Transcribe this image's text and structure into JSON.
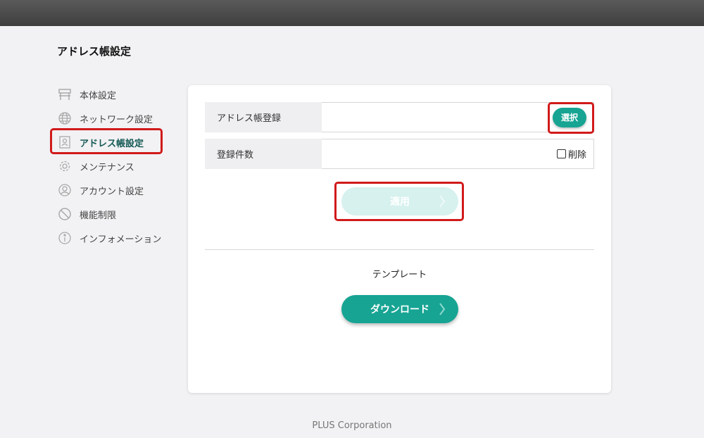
{
  "page_title": "アドレス帳設定",
  "sidebar": {
    "items": [
      {
        "label": "本体設定",
        "icon": "printer-icon"
      },
      {
        "label": "ネットワーク設定",
        "icon": "globe-icon"
      },
      {
        "label": "アドレス帳設定",
        "icon": "address-book-icon",
        "active": true
      },
      {
        "label": "メンテナンス",
        "icon": "gear-icon"
      },
      {
        "label": "アカウント設定",
        "icon": "user-icon"
      },
      {
        "label": "機能制限",
        "icon": "prohibited-icon"
      },
      {
        "label": "インフォメーション",
        "icon": "info-icon"
      }
    ]
  },
  "form": {
    "address_register_label": "アドレス帳登録",
    "select_button": "選択",
    "count_label": "登録件数",
    "delete_label": "削除",
    "delete_checked": false,
    "apply_button": "適用",
    "template_label": "テンプレート",
    "download_button": "ダウンロード"
  },
  "footer": "PLUS Corporation",
  "colors": {
    "accent": "#17a493",
    "accent_disabled": "#d6f1ee",
    "highlight": "#d11a1a",
    "active_text": "#145a55"
  }
}
